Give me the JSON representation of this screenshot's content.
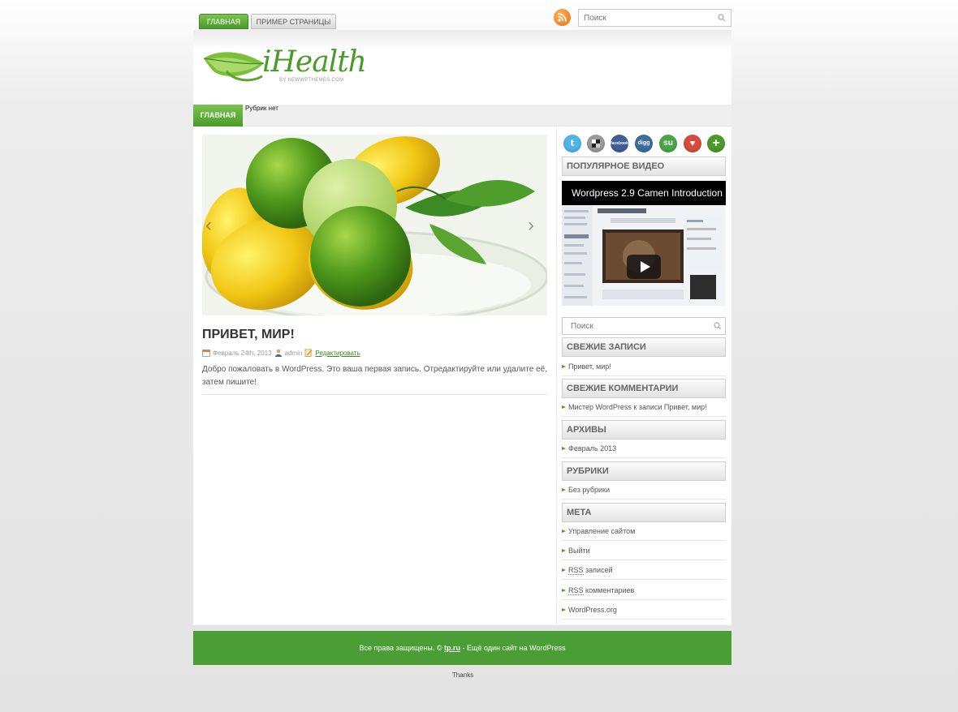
{
  "top_nav": {
    "tabs": [
      {
        "label": "ГЛАВНАЯ"
      },
      {
        "label": "ПРИМЕР СТРАНИЦЫ"
      }
    ]
  },
  "top_search": {
    "placeholder": "Поиск"
  },
  "logo": {
    "text": "iHealth",
    "sub": "BY NEWWPTHEMES.COM"
  },
  "nav": {
    "main": "ГЛАВНАЯ",
    "sub": "Рубрик нет"
  },
  "post": {
    "title": "ПРИВЕТ, МИР!",
    "date": "Февраль 24th, 2013",
    "author": "admin",
    "edit": "Редактировать",
    "text": "Добро пожаловать в WordPress. Это ваша первая запись. Отредактируйте или удалите её, затем пишите!"
  },
  "social": [
    {
      "name": "twitter",
      "label": "t",
      "color": "#4fb5e6"
    },
    {
      "name": "delicious",
      "label": "",
      "color": "#9a9a9a"
    },
    {
      "name": "facebook",
      "label": "facebook",
      "color": "#3f5e98"
    },
    {
      "name": "digg",
      "label": "digg",
      "color": "#3b6e9c"
    },
    {
      "name": "stumbleupon",
      "label": "su",
      "color": "#4aa54a"
    },
    {
      "name": "favorite",
      "label": "♥",
      "color": "#d64b3e"
    },
    {
      "name": "add",
      "label": "+",
      "color": "#4a9b2a"
    }
  ],
  "sidebar": {
    "video_heading": "ПОПУЛЯРНОЕ ВИДЕО",
    "video_title": "Wordpress 2.9 Camen Introduction",
    "search_placeholder": "Поиск",
    "recent_posts": {
      "heading": "СВЕЖИЕ ЗАПИСИ",
      "items": [
        "Привет, мир!"
      ]
    },
    "recent_comments": {
      "heading": "СВЕЖИЕ КОММЕНТАРИИ",
      "items": [
        "Мистер WordPress к записи Привет, мир!"
      ]
    },
    "archives": {
      "heading": "АРХИВЫ",
      "items": [
        "Февраль 2013"
      ]
    },
    "categories": {
      "heading": "РУБРИКИ",
      "items": [
        "Без рубрики"
      ]
    },
    "meta": {
      "heading": "МЕТА",
      "items": [
        "Управление сайтом",
        "Выйти",
        "RSS",
        "записей",
        "RSS",
        "комментариев",
        "WordPress.org"
      ]
    }
  },
  "footer": {
    "text_before": "Все права защищены. ©",
    "link": "tp.ru",
    "text_after": "- Ещё один сайт на WordPress"
  },
  "thanks": "Thanks",
  "colors": {
    "accent": "#4a9b2a",
    "footer": "#4a9e35"
  }
}
